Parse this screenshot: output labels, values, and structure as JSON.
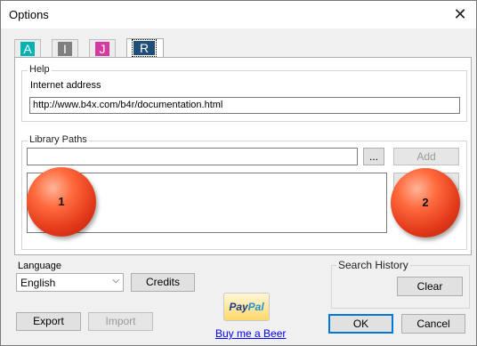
{
  "window": {
    "title": "Options",
    "close_glyph": "✕"
  },
  "tabs": [
    {
      "glyph": "A",
      "color": "#00b3b3",
      "icon": "a-tab-icon"
    },
    {
      "glyph": "I",
      "color": "#7f7f7f",
      "icon": "i-tab-icon"
    },
    {
      "glyph": "J",
      "color": "#d63aa0",
      "icon": "j-tab-icon"
    },
    {
      "glyph": "R",
      "color": "#1f4e79",
      "icon": "r-tab-icon",
      "active": true
    }
  ],
  "help": {
    "group_label": "Help",
    "internet_label": "Internet address",
    "url": "http://www.b4x.com/b4r/documentation.html"
  },
  "library": {
    "group_label": "Library Paths",
    "path_value": "",
    "browse_label": "...",
    "add_label": "Add",
    "badge_1": "1",
    "badge_2": "2"
  },
  "language": {
    "label": "Language",
    "selected": "English",
    "credits_label": "Credits"
  },
  "search_history": {
    "label": "Search History",
    "clear_label": "Clear"
  },
  "footer": {
    "export_label": "Export",
    "import_label": "Import",
    "paypal_a": "Pay",
    "paypal_b": "Pal",
    "beer_link": "Buy me a Beer",
    "ok_label": "OK",
    "cancel_label": "Cancel"
  },
  "colors": {
    "accent": "#0078d7",
    "link": "#0000ff"
  }
}
